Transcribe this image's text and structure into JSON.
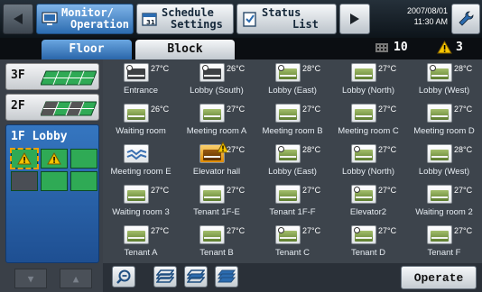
{
  "header": {
    "monitor_label": [
      "Monitor/",
      "Operation"
    ],
    "schedule_label": [
      "Schedule",
      "Settings"
    ],
    "status_label": [
      "Status",
      "List"
    ],
    "date": "2007/08/01",
    "time": "11:30 AM"
  },
  "tabs": {
    "floor": "Floor",
    "block": "Block"
  },
  "counts": {
    "buildings": "10",
    "warnings": "3"
  },
  "floors": [
    {
      "label": "3F"
    },
    {
      "label": "2F"
    },
    {
      "label": "1F Lobby"
    }
  ],
  "units": [
    {
      "name": "Entrance",
      "temp": "27°C",
      "icon": "clock-dark"
    },
    {
      "name": "Lobby (South)",
      "temp": "26°C",
      "icon": "clock-dark"
    },
    {
      "name": "Lobby (East)",
      "temp": "28°C",
      "icon": "clock"
    },
    {
      "name": "Lobby (North)",
      "temp": "27°C",
      "icon": "normal"
    },
    {
      "name": "Lobby (West)",
      "temp": "28°C",
      "icon": "clock"
    },
    {
      "name": "Waiting room",
      "temp": "26°C",
      "icon": "normal"
    },
    {
      "name": "Meeting room A",
      "temp": "27°C",
      "icon": "normal"
    },
    {
      "name": "Meeting room B",
      "temp": "27°C",
      "icon": "normal"
    },
    {
      "name": "Meeting room C",
      "temp": "27°C",
      "icon": "normal"
    },
    {
      "name": "Meeting room D",
      "temp": "27°C",
      "icon": "normal"
    },
    {
      "name": "Meeting room E",
      "temp": "",
      "icon": "fan"
    },
    {
      "name": "Elevator hall",
      "temp": "27°C",
      "icon": "warning"
    },
    {
      "name": "Lobby (East)",
      "temp": "28°C",
      "icon": "clock"
    },
    {
      "name": "Lobby (North)",
      "temp": "27°C",
      "icon": "clock"
    },
    {
      "name": "Lobby (West)",
      "temp": "28°C",
      "icon": "normal"
    },
    {
      "name": "Waiting room 3",
      "temp": "27°C",
      "icon": "normal"
    },
    {
      "name": "Tenant 1F-E",
      "temp": "27°C",
      "icon": "normal"
    },
    {
      "name": "Tenant 1F-F",
      "temp": "27°C",
      "icon": "normal"
    },
    {
      "name": "Elevator2",
      "temp": "27°C",
      "icon": "clock"
    },
    {
      "name": "Waiting room 2",
      "temp": "27°C",
      "icon": "normal"
    },
    {
      "name": "Tenant A",
      "temp": "27°C",
      "icon": "normal"
    },
    {
      "name": "Tenant B",
      "temp": "27°C",
      "icon": "normal"
    },
    {
      "name": "Tenant C",
      "temp": "27°C",
      "icon": "clock"
    },
    {
      "name": "Tenant D",
      "temp": "27°C",
      "icon": "clock"
    },
    {
      "name": "Tenant F",
      "temp": "27°C",
      "icon": "normal"
    }
  ],
  "footer": {
    "operate_label": "Operate"
  },
  "colors": {
    "accent": "#2c6cb0",
    "unit_green": "#7aa04a",
    "warning": "#f5c400"
  }
}
